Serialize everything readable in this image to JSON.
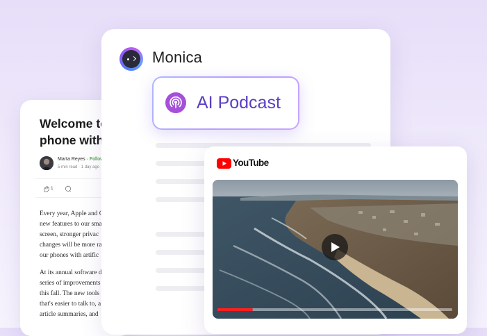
{
  "article": {
    "title_lines": [
      "Welcome to",
      "phone with"
    ],
    "author": "Marta Reyes",
    "separator": "·",
    "follow_label": "Follow",
    "read_time": "5 min read",
    "published": "1 day ago",
    "clap_count": "1",
    "paragraph1": [
      "Every year, Apple and G",
      "new features to our sma",
      "screen, stronger privac",
      "changes will be more ra",
      "our phones with artific"
    ],
    "paragraph2": [
      "At its annual software d",
      "series of improvements",
      "this fall. The new tools",
      "that's easier to talk to, a",
      "article summaries, and"
    ]
  },
  "monica": {
    "app_name": "Monica",
    "podcast_label": "AI Podcast"
  },
  "youtube": {
    "wordmark": "YouTube",
    "progress": 0.15
  },
  "colors": {
    "accent_purple": "#5b3fc2",
    "podcast_icon": "#a64fd9",
    "youtube_red": "#ff0000"
  }
}
